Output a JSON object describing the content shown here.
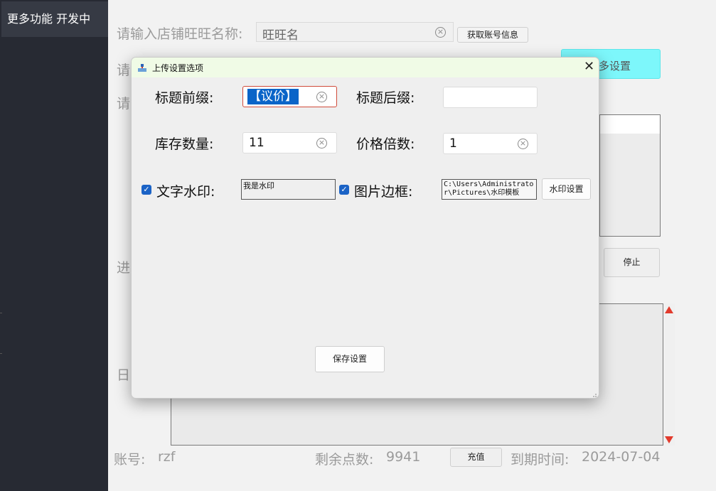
{
  "sidebar": {
    "header": "更多功能 开发中"
  },
  "main": {
    "shop_label": "请输入店铺旺旺名称:",
    "shop_input_value": "旺旺名",
    "get_account_button": "获取账号信息",
    "row2_label_fragment": "请",
    "row3_label_fragment": "请",
    "more_settings_button": "多设置",
    "progress_label_fragment": "进",
    "stop_button": "停止",
    "log_label_fragment": "日",
    "account_label": "账号:",
    "account_value": "rzf",
    "points_label": "剩余点数:",
    "points_value": "9941",
    "recharge_button": "充值",
    "expiry_label": "到期时间:",
    "expiry_value": "2024-07-04"
  },
  "dialog": {
    "title": "上传设置选项",
    "title_prefix_label": "标题前缀:",
    "title_prefix_value": "【议价】",
    "title_suffix_label": "标题后缀:",
    "title_suffix_value": "",
    "stock_label": "库存数量:",
    "stock_value": "11",
    "price_multiplier_label": "价格倍数:",
    "price_multiplier_value": "1",
    "text_watermark_label": "文字水印:",
    "text_watermark_checked": true,
    "text_watermark_value": "我是水印",
    "image_border_label": "图片边框:",
    "image_border_checked": true,
    "image_border_path": "C:\\Users\\Administrator\\Pictures\\水印模板",
    "watermark_settings_button": "水印设置",
    "save_button": "保存设置"
  },
  "colors": {
    "sidebar_bg": "#272a33",
    "checkbox": "#1b63c6",
    "highlight": "#0a64c8",
    "accent_cyan": "#7df7fb"
  }
}
